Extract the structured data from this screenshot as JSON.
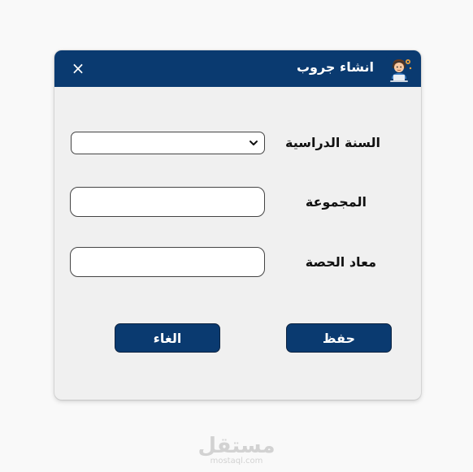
{
  "dialog": {
    "title": "انشاء جروب",
    "close_symbol": "×",
    "colors": {
      "accent": "#0a3a70",
      "background": "#f0f0f0"
    }
  },
  "form": {
    "academic_year_label": "السنة الدراسية",
    "academic_year_value": "",
    "group_label": "المجموعة",
    "group_value": "",
    "session_time_label": "معاد الحصة",
    "session_time_value": ""
  },
  "buttons": {
    "save_label": "حفظ",
    "cancel_label": "الغاء"
  },
  "watermark": {
    "logo_text": "مستقل",
    "domain_text": "mostaql.com"
  }
}
